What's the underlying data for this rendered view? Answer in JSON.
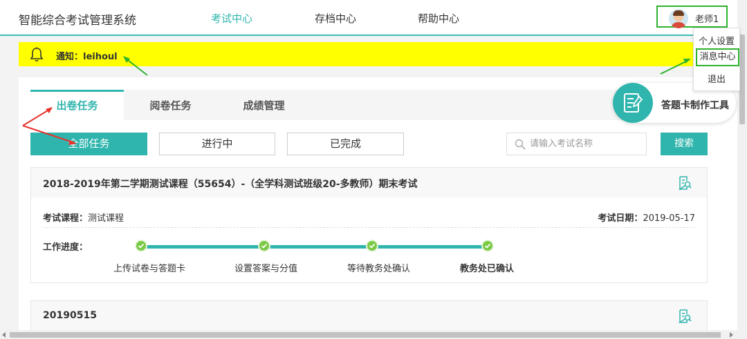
{
  "header": {
    "app_title": "智能综合考试管理系统",
    "nav": [
      "考试中心",
      "存档中心",
      "帮助中心"
    ],
    "active_nav": "考试中心",
    "user_name": "老师1"
  },
  "user_menu": {
    "items": [
      "个人设置",
      "消息中心",
      "退出"
    ],
    "highlighted": "消息中心"
  },
  "notice": {
    "text": "通知：leihoul"
  },
  "tabs": [
    "出卷任务",
    "阅卷任务",
    "成绩管理"
  ],
  "active_tab": "出卷任务",
  "filters": [
    "全部任务",
    "进行中",
    "已完成"
  ],
  "active_filter": "全部任务",
  "search": {
    "placeholder": "请输入考试名称",
    "button_label": "搜索"
  },
  "tool": {
    "label": "答题卡制作工具"
  },
  "exams": [
    {
      "title": "2018-2019年第二学期测试课程（55654）-（全学科测试班级20-多教师）期末考试",
      "course_label": "考试课程：",
      "course_value": "测试课程",
      "date_label": "考试日期：",
      "date_value": "2019-05-17",
      "progress_label": "工作进度：",
      "steps": [
        "上传试卷与答题卡",
        "设置答案与分值",
        "等待教务处确认",
        "教务处已确认"
      ]
    },
    {
      "title": "20190515"
    }
  ],
  "colors": {
    "accent": "#2fb5ad",
    "notice_bg": "#ffff00",
    "step_done": "#7ac943",
    "highlight_border": "#2cb22c",
    "annotation_red": "#e8322d",
    "annotation_green": "#2cb22c"
  }
}
